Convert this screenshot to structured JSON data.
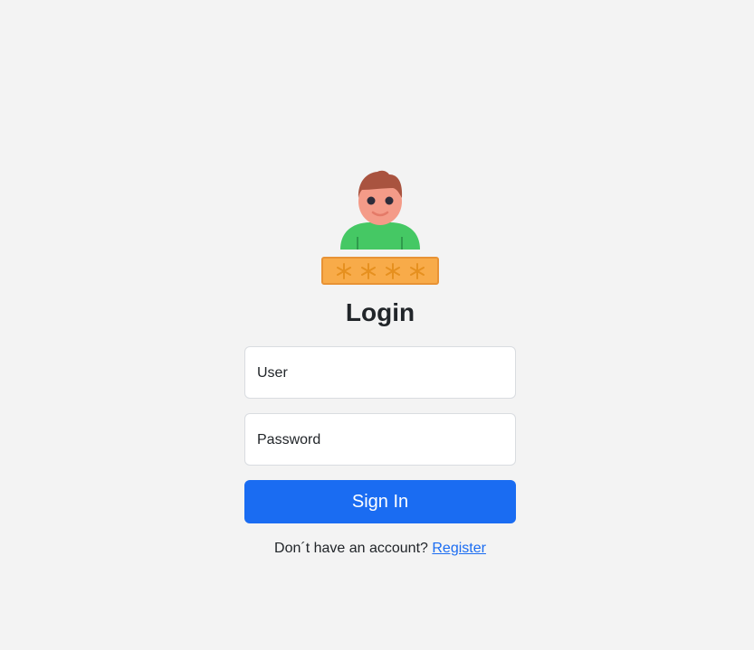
{
  "login": {
    "title": "Login",
    "user_placeholder": "User",
    "password_placeholder": "Password",
    "signin_label": "Sign In",
    "no_account_text": "Don´t have an account?",
    "register_link": "Register"
  },
  "illustration": {
    "icon": "user-password-icon",
    "password_mask": "****"
  },
  "colors": {
    "background": "#f3f3f3",
    "primary": "#1a6cf2",
    "field_border": "#d9dce0",
    "password_bar": "#f8ab49"
  }
}
